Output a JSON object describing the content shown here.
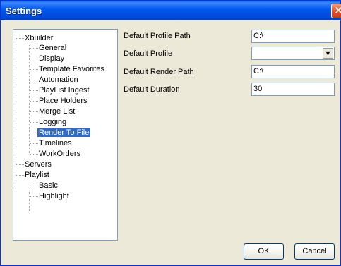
{
  "window": {
    "title": "Settings",
    "close_glyph": "✕"
  },
  "tree": {
    "root": "Xbuilder",
    "xbuilder_children": [
      "General",
      "Display",
      "Template Favorites",
      "Automation",
      "PlayList Ingest",
      "Place Holders",
      "Merge List",
      "Logging",
      "Render To File",
      "Timelines",
      "WorkOrders"
    ],
    "selected": "Render To File",
    "servers": "Servers",
    "playlist": "Playlist",
    "playlist_children": [
      "Basic",
      "Highlight"
    ]
  },
  "form": {
    "profile_path_label": "Default Profile Path",
    "profile_path_value": "C:\\",
    "profile_label": "Default Profile",
    "profile_value": "",
    "render_path_label": "Default Render Path",
    "render_path_value": "C:\\",
    "duration_label": "Default Duration",
    "duration_value": "30"
  },
  "buttons": {
    "ok": "OK",
    "cancel": "Cancel"
  },
  "icons": {
    "dropdown": "▼"
  }
}
